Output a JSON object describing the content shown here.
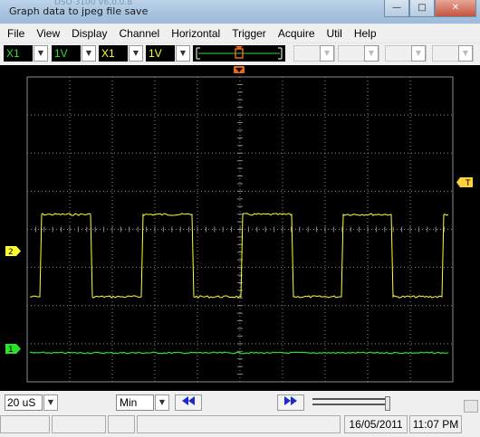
{
  "window": {
    "title": "Graph data to jpeg file save",
    "faded_title": "DSO 3100 V6.0.0.8",
    "controls": [
      "—",
      "□",
      "✕"
    ]
  },
  "menu": [
    "File",
    "View",
    "Display",
    "Channel",
    "Horizontal",
    "Trigger",
    "Acquire",
    "Util",
    "Help"
  ],
  "toolbar": {
    "ch1_probe": "X1",
    "ch1_volts": "1V",
    "ch2_probe": "X1",
    "ch2_volts": "1V"
  },
  "scope": {
    "markers": {
      "trigger_level": "T",
      "ch2_marker": "2",
      "ch1_marker": "1"
    },
    "colors": {
      "ch1": "#2ee02e",
      "ch2": "#ffff33",
      "trigger": "#ffd23a",
      "trigger_position": "#e8671a",
      "grid": "#8a8a8a"
    }
  },
  "status": {
    "timebase": "20 uS",
    "mode": "Min",
    "date": "16/05/2011",
    "time": "11:07 PM"
  }
}
